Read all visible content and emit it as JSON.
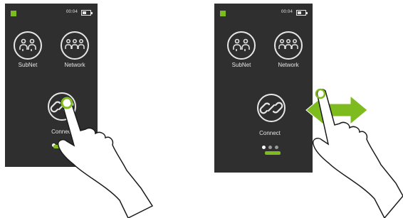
{
  "screens": [
    {
      "status": {
        "time": "00:04"
      },
      "apps": [
        {
          "label": "SubNet",
          "icon": "subnet-people-icon"
        },
        {
          "label": "Network",
          "icon": "network-people-icon"
        },
        {
          "label": "Connect",
          "icon": "link-icon"
        }
      ],
      "gesture": "tap-hand-icon"
    },
    {
      "status": {
        "time": "00:04"
      },
      "apps": [
        {
          "label": "SubNet",
          "icon": "subnet-people-icon"
        },
        {
          "label": "Network",
          "icon": "network-people-icon"
        },
        {
          "label": "Connect",
          "icon": "link-icon"
        }
      ],
      "gesture": "swipe-hand-icon"
    }
  ],
  "colors": {
    "screen": "#2f2f2f",
    "accent": "#7dbb1e",
    "text": "#e6e6e6",
    "skin": "#ffffff"
  }
}
